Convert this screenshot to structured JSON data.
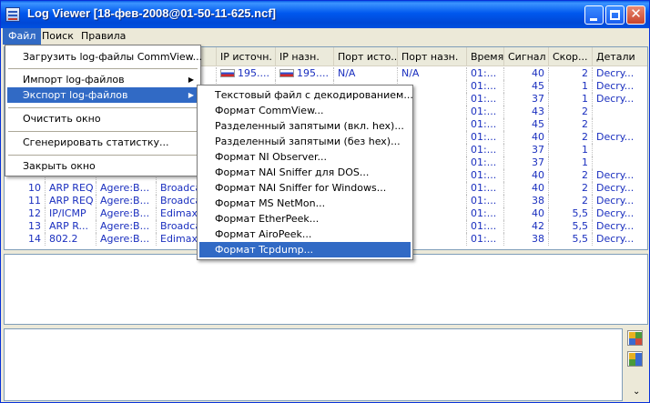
{
  "window": {
    "title": "Log Viewer [18-фев-2008@01-50-11-625.ncf]"
  },
  "menubar": {
    "items": [
      "Файл",
      "Поиск",
      "Правила"
    ]
  },
  "table": {
    "headers": [
      "",
      "",
      "",
      "",
      "IP источн.",
      "IP назн.",
      "Порт исто...",
      "Порт назн.",
      "Время",
      "Сигнал",
      "Скор...",
      "Детали"
    ],
    "rows": [
      {
        "no": "",
        "proto": "",
        "src": "",
        "dst": "",
        "ipsrc": "195....",
        "ipdst": "195....",
        "psrc": "N/A",
        "pdst": "N/A",
        "time": "01:...",
        "signal": "40",
        "speed": "2",
        "details": "Decry..."
      },
      {
        "no": "",
        "proto": "",
        "src": "",
        "dst": "",
        "ipsrc": "",
        "ipdst": "",
        "psrc": "",
        "pdst": "",
        "time": "01:...",
        "signal": "45",
        "speed": "1",
        "details": "Decry..."
      },
      {
        "no": "",
        "proto": "",
        "src": "",
        "dst": "",
        "ipsrc": "",
        "ipdst": "",
        "psrc": "",
        "pdst": "",
        "time": "01:...",
        "signal": "37",
        "speed": "1",
        "details": "Decry..."
      },
      {
        "no": "",
        "proto": "",
        "src": "",
        "dst": "",
        "ipsrc": "",
        "ipdst": "",
        "psrc": "",
        "pdst": "",
        "time": "01:...",
        "signal": "43",
        "speed": "2",
        "details": ""
      },
      {
        "no": "",
        "proto": "",
        "src": "",
        "dst": "",
        "ipsrc": "",
        "ipdst": "",
        "psrc": "",
        "pdst": "",
        "time": "01:...",
        "signal": "45",
        "speed": "2",
        "details": ""
      },
      {
        "no": "",
        "proto": "",
        "src": "",
        "dst": "",
        "ipsrc": "",
        "ipdst": "",
        "psrc": "",
        "pdst": "",
        "time": "01:...",
        "signal": "40",
        "speed": "2",
        "details": "Decry..."
      },
      {
        "no": "",
        "proto": "",
        "src": "",
        "dst": "",
        "ipsrc": "",
        "ipdst": "",
        "psrc": "",
        "pdst": "",
        "time": "01:...",
        "signal": "37",
        "speed": "1",
        "details": ""
      },
      {
        "no": "",
        "proto": "",
        "src": "",
        "dst": "",
        "ipsrc": "",
        "ipdst": "",
        "psrc": "",
        "pdst": "",
        "time": "01:...",
        "signal": "37",
        "speed": "1",
        "details": ""
      },
      {
        "no": "",
        "proto": "",
        "src": "",
        "dst": "",
        "ipsrc": "",
        "ipdst": "",
        "psrc": "",
        "pdst": "",
        "time": "01:...",
        "signal": "40",
        "speed": "2",
        "details": "Decry..."
      },
      {
        "no": "10",
        "proto": "ARP REQ",
        "src": "Agere:B...",
        "dst": "Broadcas",
        "ipsrc": "",
        "ipdst": "",
        "psrc": "",
        "pdst": "",
        "time": "01:...",
        "signal": "40",
        "speed": "2",
        "details": "Decry..."
      },
      {
        "no": "11",
        "proto": "ARP REQ",
        "src": "Agere:B...",
        "dst": "Broadcas",
        "ipsrc": "",
        "ipdst": "",
        "psrc": "",
        "pdst": "",
        "time": "01:...",
        "signal": "38",
        "speed": "2",
        "details": "Decry..."
      },
      {
        "no": "12",
        "proto": "IP/ICMP",
        "src": "Agere:B...",
        "dst": "EdimaxT",
        "ipsrc": "",
        "ipdst": "",
        "psrc": "",
        "pdst": "",
        "time": "01:...",
        "signal": "40",
        "speed": "5,5",
        "details": "Decry..."
      },
      {
        "no": "13",
        "proto": "ARP R...",
        "src": "Agere:B...",
        "dst": "Broadcas",
        "ipsrc": "",
        "ipdst": "",
        "psrc": "",
        "pdst": "",
        "time": "01:...",
        "signal": "42",
        "speed": "5,5",
        "details": "Decry..."
      },
      {
        "no": "14",
        "proto": "802.2",
        "src": "Agere:B...",
        "dst": "EdimaxT",
        "ipsrc": "",
        "ipdst": "",
        "psrc": "",
        "pdst": "",
        "time": "01:...",
        "signal": "38",
        "speed": "5,5",
        "details": "Decry..."
      }
    ]
  },
  "file_menu": {
    "items": [
      {
        "label": "Загрузить log-файлы CommView...",
        "has_sub": false
      },
      {
        "label": "Импорт log-файлов",
        "has_sub": true
      },
      {
        "label": "Экспорт log-файлов",
        "has_sub": true
      },
      {
        "label": "Очистить окно",
        "has_sub": false
      },
      {
        "label": "Сгенерировать статистку...",
        "has_sub": false
      },
      {
        "label": "Закрыть окно",
        "has_sub": false
      }
    ]
  },
  "export_menu": {
    "items": [
      "Текстовый файл с декодированием...",
      "Формат CommView...",
      "Разделенный запятыми (вкл. hex)...",
      "Разделенный запятыми (без hex)...",
      "Формат NI Observer...",
      "Формат NAI Sniffer для DOS...",
      "Формат NAI Sniffer for Windows...",
      "Формат MS NetMon...",
      "Формат EtherPeek...",
      "Формат AiroPeek...",
      "Формат Tcpdump..."
    ]
  },
  "colors": {
    "accent": "#316ac5",
    "text_blue": "#1a2fbf",
    "titlebar": "#0058ee"
  }
}
